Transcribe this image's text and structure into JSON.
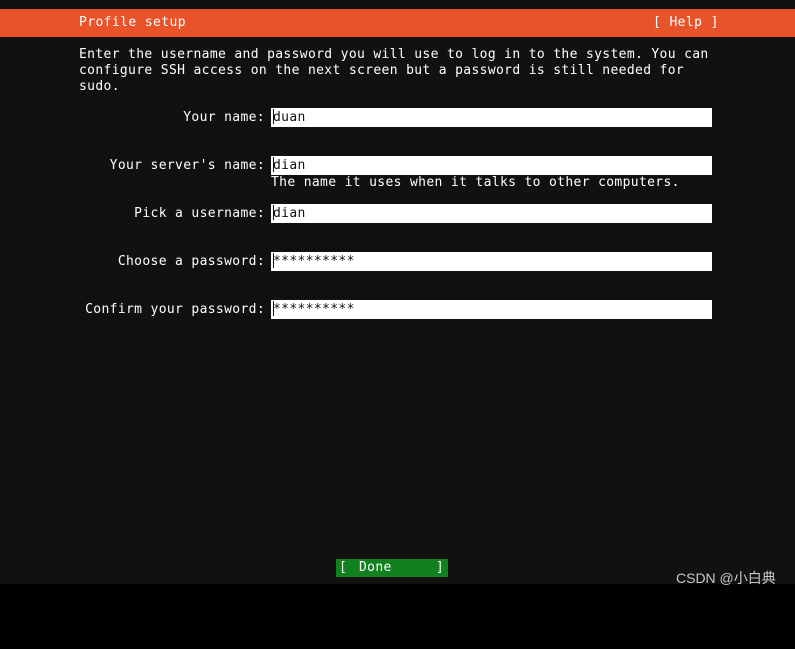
{
  "header": {
    "title": "Profile setup",
    "help_label": "[ Help ]",
    "background_color": "#e8532a",
    "text_color": "#ffffff"
  },
  "intro": {
    "text": "Enter the username and password you will use to log in to the system. You can configure SSH access on the next screen but a password is still needed for sudo."
  },
  "form": {
    "fields": [
      {
        "label": "Your name:",
        "value": "duan",
        "hint": ""
      },
      {
        "label": "Your server's name:",
        "value": "dian",
        "hint": "The name it uses when it talks to other computers."
      },
      {
        "label": "Pick a username:",
        "value": "dian",
        "hint": ""
      },
      {
        "label": "Choose a password:",
        "value": "**********",
        "hint": ""
      },
      {
        "label": "Confirm your password:",
        "value": "**********",
        "hint": ""
      }
    ]
  },
  "footer": {
    "done_bracket_left": "[",
    "done_label": "Done",
    "done_bracket_right": "]",
    "done_background_color": "#11801e",
    "watermark": "CSDN @小白典"
  },
  "colors": {
    "terminal_background": "#111111",
    "screen_background": "#000000",
    "input_background": "#ffffff",
    "input_text": "#111111"
  }
}
